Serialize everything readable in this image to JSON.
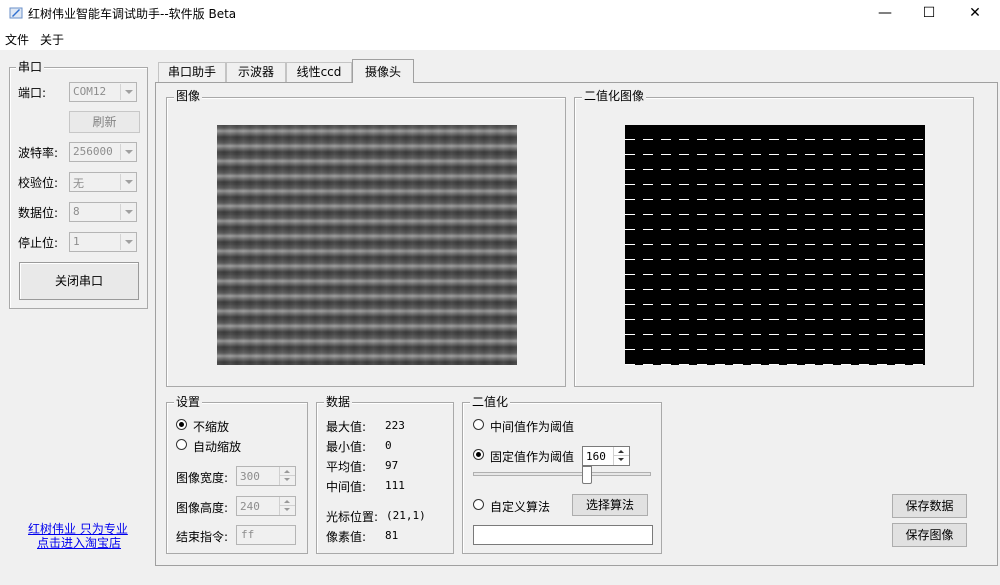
{
  "window": {
    "title": "红树伟业智能车调试助手--软件版 Beta",
    "minimize": "—",
    "maximize": "☐",
    "close": "✕"
  },
  "menu": {
    "file": "文件",
    "about": "关于"
  },
  "serial": {
    "group_title": "串口",
    "port_label": "端口:",
    "port_value": "COM12",
    "refresh_label": "刷新",
    "baud_label": "波特率:",
    "baud_value": "256000",
    "parity_label": "校验位:",
    "parity_value": "无",
    "databits_label": "数据位:",
    "databits_value": "8",
    "stopbits_label": "停止位:",
    "stopbits_value": "1",
    "close_port_label": "关闭串口"
  },
  "links": {
    "line1": "红树伟业 只为专业",
    "line2": "点击进入淘宝店"
  },
  "tabs": [
    "串口助手",
    "示波器",
    "线性ccd",
    "摄像头"
  ],
  "image_panel": {
    "title": "图像"
  },
  "binary_panel": {
    "title": "二值化图像"
  },
  "settings": {
    "title": "设置",
    "no_scale": "不缩放",
    "auto_scale": "自动缩放",
    "width_label": "图像宽度:",
    "width_value": "300",
    "height_label": "图像高度:",
    "height_value": "240",
    "end_cmd_label": "结束指令:",
    "end_cmd_value": "ff"
  },
  "data": {
    "title": "数据",
    "max_label": "最大值:",
    "max_value": "223",
    "min_label": "最小值:",
    "min_value": "0",
    "avg_label": "平均值:",
    "avg_value": "97",
    "median_label": "中间值:",
    "median_value": "111",
    "cursor_label": "光标位置:",
    "cursor_value": "(21,1)",
    "pixel_label": "像素值:",
    "pixel_value": "81"
  },
  "binarize": {
    "title": "二值化",
    "median_threshold": "中间值作为阈值",
    "fixed_threshold": "固定值作为阈值",
    "threshold_value": "160",
    "slider_fraction": 0.64,
    "custom_algo": "自定义算法",
    "select_algo": "选择算法",
    "algo_path": ""
  },
  "actions": {
    "save_data": "保存数据",
    "save_image": "保存图像"
  }
}
